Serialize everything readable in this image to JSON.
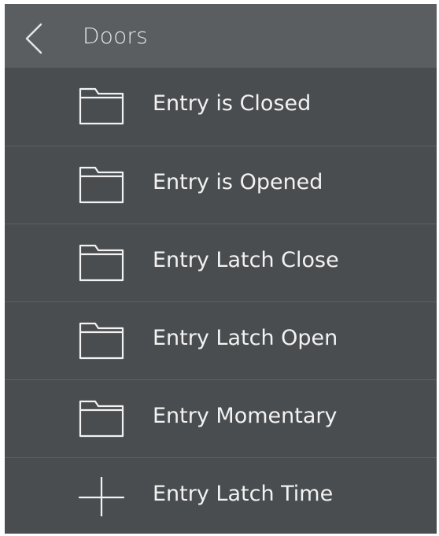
{
  "header": {
    "title": "Doors",
    "back_icon": "chevron-left-icon"
  },
  "list": {
    "items": [
      {
        "label": "Entry is Closed",
        "icon": "folder-icon"
      },
      {
        "label": "Entry is Opened",
        "icon": "folder-icon"
      },
      {
        "label": "Entry Latch Close",
        "icon": "folder-icon"
      },
      {
        "label": "Entry Latch Open",
        "icon": "folder-icon"
      },
      {
        "label": "Entry Momentary",
        "icon": "folder-icon"
      },
      {
        "label": "Entry Latch Time",
        "icon": "plus-icon"
      }
    ]
  },
  "colors": {
    "background": "#4a4d50",
    "header": "#5b5e61",
    "divider": "#5d6064",
    "text": "#f2f2f2"
  }
}
